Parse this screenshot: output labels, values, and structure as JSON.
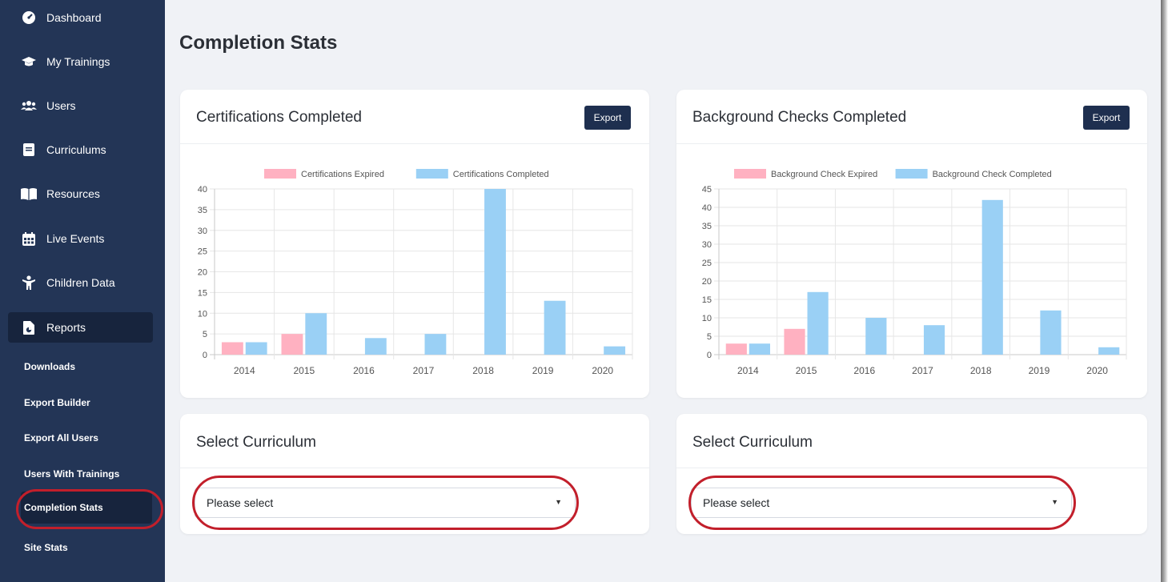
{
  "sidebar": {
    "items": [
      {
        "label": "Dashboard",
        "icon": "dashboard-icon"
      },
      {
        "label": "My Trainings",
        "icon": "graduation-cap-icon"
      },
      {
        "label": "Users",
        "icon": "users-icon"
      },
      {
        "label": "Curriculums",
        "icon": "book-icon"
      },
      {
        "label": "Resources",
        "icon": "open-book-icon"
      },
      {
        "label": "Live Events",
        "icon": "calendar-icon"
      },
      {
        "label": "Children Data",
        "icon": "child-icon"
      },
      {
        "label": "Reports",
        "icon": "report-icon",
        "active": true
      }
    ],
    "sub_items": [
      {
        "label": "Downloads"
      },
      {
        "label": "Export Builder"
      },
      {
        "label": "Export All Users"
      },
      {
        "label": "Users With Trainings"
      },
      {
        "label": "Completion Stats",
        "active": true
      },
      {
        "label": "Site Stats"
      }
    ]
  },
  "page": {
    "title": "Completion Stats"
  },
  "cards": {
    "certifications": {
      "title": "Certifications Completed",
      "export_label": "Export"
    },
    "background": {
      "title": "Background Checks Completed",
      "export_label": "Export"
    },
    "curriculum_left": {
      "title": "Select Curriculum",
      "select_value": "Please select"
    },
    "curriculum_right": {
      "title": "Select Curriculum",
      "select_value": "Please select"
    }
  },
  "colors": {
    "sidebar_bg": "#233556",
    "expired": "#ffb1c1",
    "completed": "#9ad0f5",
    "export_button": "#1e2f4f",
    "highlight": "#c21f2b"
  },
  "chart_data": [
    {
      "type": "bar",
      "categories": [
        "2014",
        "2015",
        "2016",
        "2017",
        "2018",
        "2019",
        "2020"
      ],
      "series": [
        {
          "name": "Certifications Expired",
          "values": [
            3,
            5,
            0,
            0,
            0,
            0,
            0
          ],
          "color": "#ffb1c1"
        },
        {
          "name": "Certifications Completed",
          "values": [
            3,
            10,
            4,
            5,
            40,
            13,
            2
          ],
          "color": "#9ad0f5"
        }
      ],
      "y_ticks": [
        "0",
        "5",
        "10",
        "15",
        "20",
        "25",
        "30",
        "35",
        "40"
      ],
      "ylim": [
        0,
        40
      ],
      "legend": "top",
      "grid": true
    },
    {
      "type": "bar",
      "categories": [
        "2014",
        "2015",
        "2016",
        "2017",
        "2018",
        "2019",
        "2020"
      ],
      "series": [
        {
          "name": "Background Check Expired",
          "values": [
            3,
            7,
            0,
            0,
            0,
            0,
            0
          ],
          "color": "#ffb1c1"
        },
        {
          "name": "Background Check Completed",
          "values": [
            3,
            17,
            10,
            8,
            42,
            12,
            2
          ],
          "color": "#9ad0f5"
        }
      ],
      "y_ticks": [
        "0",
        "5",
        "10",
        "15",
        "20",
        "25",
        "30",
        "35",
        "40",
        "45"
      ],
      "ylim": [
        0,
        45
      ],
      "legend": "top",
      "grid": true
    }
  ]
}
